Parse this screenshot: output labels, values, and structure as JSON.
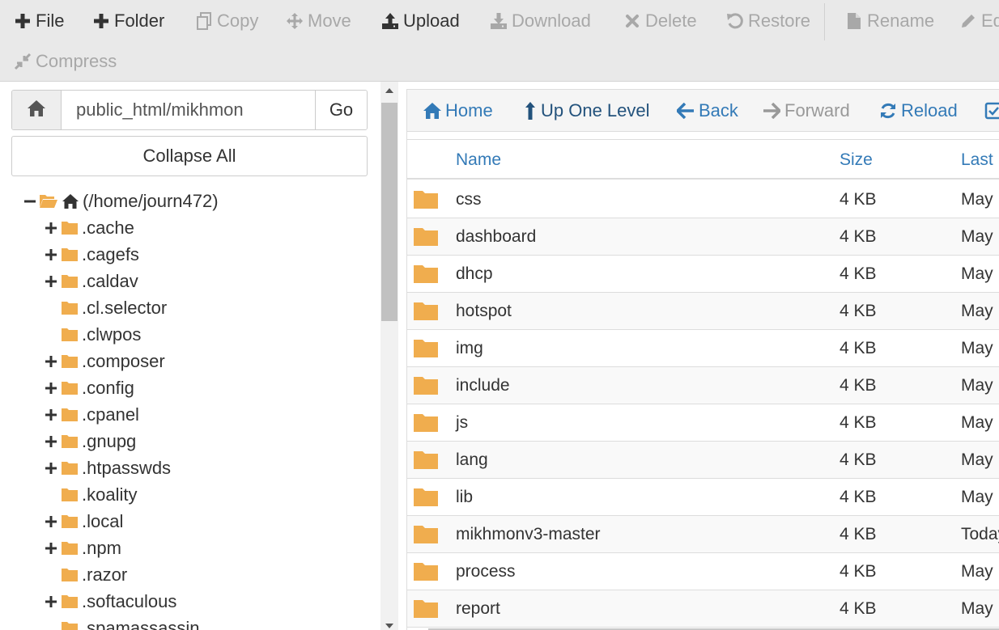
{
  "toolbar": {
    "file": "File",
    "folder": "Folder",
    "copy": "Copy",
    "move": "Move",
    "upload": "Upload",
    "download": "Download",
    "delete": "Delete",
    "restore": "Restore",
    "rename": "Rename",
    "edit": "Ed",
    "compress": "Compress"
  },
  "path": {
    "value": "public_html/mikhmon",
    "go_label": "Go"
  },
  "collapse_label": "Collapse All",
  "tree": {
    "root": "(/home/journ472)",
    "items": [
      {
        "label": ".cache",
        "expandable": true
      },
      {
        "label": ".cagefs",
        "expandable": true
      },
      {
        "label": ".caldav",
        "expandable": true
      },
      {
        "label": ".cl.selector",
        "expandable": false
      },
      {
        "label": ".clwpos",
        "expandable": false
      },
      {
        "label": ".composer",
        "expandable": true
      },
      {
        "label": ".config",
        "expandable": true
      },
      {
        "label": ".cpanel",
        "expandable": true
      },
      {
        "label": ".gnupg",
        "expandable": true
      },
      {
        "label": ".htpasswds",
        "expandable": true
      },
      {
        "label": ".koality",
        "expandable": false
      },
      {
        "label": ".local",
        "expandable": true
      },
      {
        "label": ".npm",
        "expandable": true
      },
      {
        "label": ".razor",
        "expandable": false
      },
      {
        "label": ".softaculous",
        "expandable": true
      },
      {
        "label": ".spamassassin",
        "expandable": false
      }
    ]
  },
  "nav": {
    "home": "Home",
    "up_one_level": "Up One Level",
    "back": "Back",
    "forward": "Forward",
    "reload": "Reload"
  },
  "table": {
    "headers": {
      "name": "Name",
      "size": "Size",
      "last": "Last"
    },
    "rows": [
      {
        "name": "css",
        "size": "4 KB",
        "date": "May"
      },
      {
        "name": "dashboard",
        "size": "4 KB",
        "date": "May"
      },
      {
        "name": "dhcp",
        "size": "4 KB",
        "date": "May"
      },
      {
        "name": "hotspot",
        "size": "4 KB",
        "date": "May"
      },
      {
        "name": "img",
        "size": "4 KB",
        "date": "May"
      },
      {
        "name": "include",
        "size": "4 KB",
        "date": "May"
      },
      {
        "name": "js",
        "size": "4 KB",
        "date": "May"
      },
      {
        "name": "lang",
        "size": "4 KB",
        "date": "May"
      },
      {
        "name": "lib",
        "size": "4 KB",
        "date": "May"
      },
      {
        "name": "mikhmonv3-master",
        "size": "4 KB",
        "date": "Today"
      },
      {
        "name": "process",
        "size": "4 KB",
        "date": "May"
      },
      {
        "name": "report",
        "size": "4 KB",
        "date": "May"
      }
    ]
  },
  "colors": {
    "folder": "#f0ad4e",
    "link": "#337ab7",
    "disabled": "#a8a8a8",
    "toolbar_bg": "#e9e9e9"
  }
}
